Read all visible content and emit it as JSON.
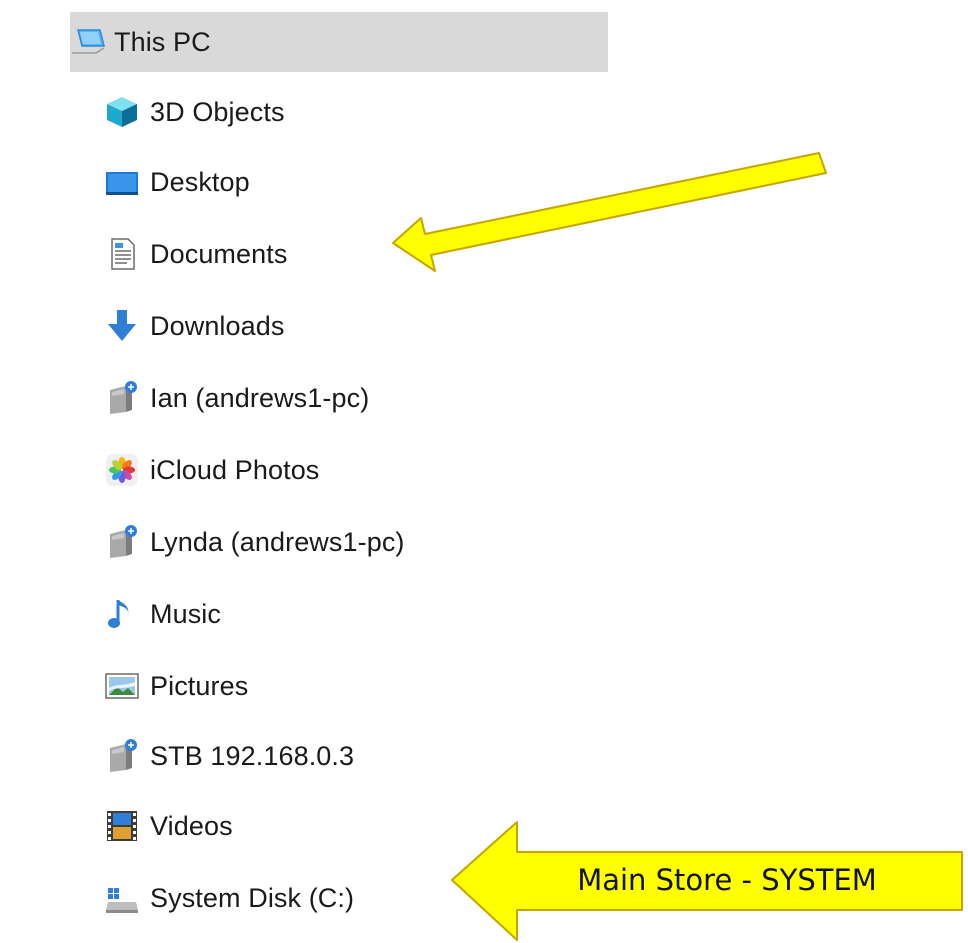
{
  "nav_tree": {
    "root": {
      "label": "This PC",
      "icon": "this-pc-icon",
      "selected": true
    },
    "items": [
      {
        "label": "3D Objects",
        "icon": "3d-objects-icon"
      },
      {
        "label": "Desktop",
        "icon": "desktop-icon"
      },
      {
        "label": "Documents",
        "icon": "documents-icon"
      },
      {
        "label": "Downloads",
        "icon": "downloads-icon"
      },
      {
        "label": "Ian (andrews1-pc)",
        "icon": "network-drive-icon"
      },
      {
        "label": "iCloud Photos",
        "icon": "icloud-photos-icon"
      },
      {
        "label": "Lynda (andrews1-pc)",
        "icon": "network-drive-icon"
      },
      {
        "label": "Music",
        "icon": "music-icon"
      },
      {
        "label": "Pictures",
        "icon": "pictures-icon"
      },
      {
        "label": "STB 192.168.0.3",
        "icon": "network-drive-icon"
      },
      {
        "label": "Videos",
        "icon": "videos-icon"
      },
      {
        "label": "System Disk (C:)",
        "icon": "system-disk-icon"
      }
    ]
  },
  "annotations": {
    "callout_label": "Main Store - SYSTEM",
    "arrow_color": "#ffff00",
    "arrow_outline": "#c8a400"
  },
  "colors": {
    "selection_background": "#d9d9d9"
  }
}
